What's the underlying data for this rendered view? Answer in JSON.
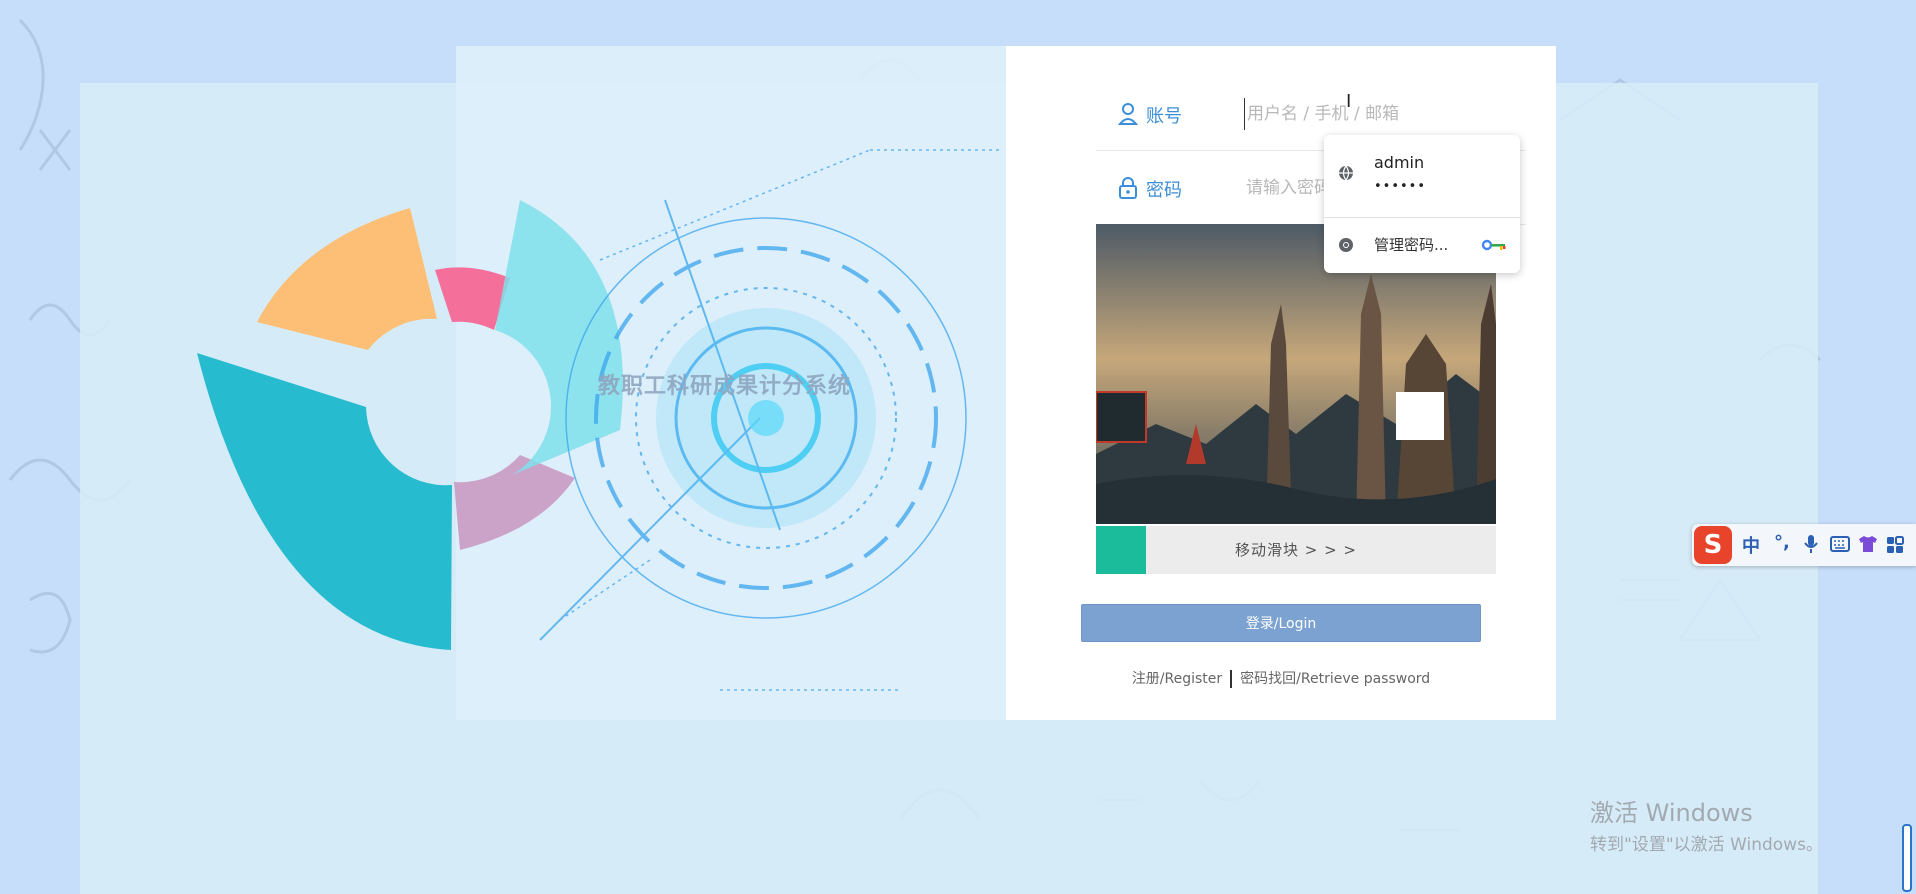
{
  "app": {
    "system_title": "教职工科研成果计分系统"
  },
  "login": {
    "account": {
      "label": "账号",
      "placeholder": "用户名 / 手机 / 邮箱",
      "value": ""
    },
    "password": {
      "label": "密码",
      "placeholder": "请输入密码",
      "value": ""
    },
    "slider_text": "移动滑块 > > >",
    "login_button": "登录/Login",
    "register_link": "注册/Register",
    "retrieve_link": "密码找回/Retrieve password"
  },
  "autofill": {
    "username": "admin",
    "password_mask": "••••••",
    "manage_label": "管理密码...",
    "icons": [
      "globe-icon",
      "chrome-icon",
      "key-icon"
    ]
  },
  "ime": {
    "logo": "S",
    "buttons": [
      "中",
      "°,",
      "mic-icon",
      "keyboard-icon",
      "shirt-icon",
      "grid-icon"
    ],
    "lang_label": "中",
    "punct_label": "°,"
  },
  "watermark": {
    "line1": "激活 Windows",
    "line2": "转到\"设置\"以激活 Windows。"
  },
  "colors": {
    "accent": "#3c8ed8",
    "slider_handle": "#1abc9c",
    "login_button": "#7ba2d0",
    "background": "#c6defa"
  }
}
